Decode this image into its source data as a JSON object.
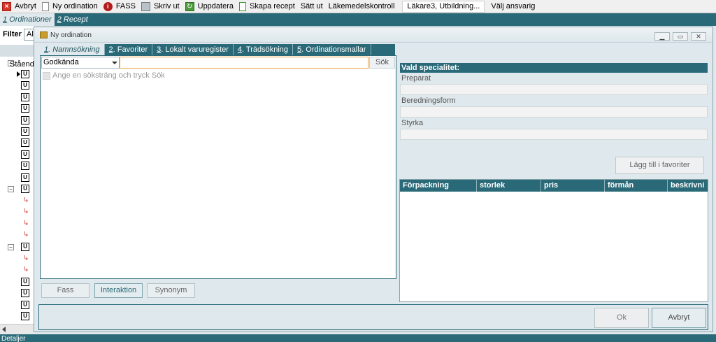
{
  "toolbar": {
    "items": [
      {
        "label": "Avbryt",
        "icon": "close-icon"
      },
      {
        "label": "Ny ordination",
        "icon": "document-icon"
      },
      {
        "label": "FASS",
        "icon": "fass-icon"
      },
      {
        "label": "Skriv ut",
        "icon": "printer-icon"
      },
      {
        "label": "Uppdatera",
        "icon": "refresh-icon"
      },
      {
        "label": "Skapa recept",
        "icon": "new-prescription-icon"
      },
      {
        "label": "Sätt ut"
      },
      {
        "label": "Läkemedelskontroll"
      },
      {
        "label": "Läkare3,  Utbildning..."
      },
      {
        "label": "Välj ansvarig"
      }
    ]
  },
  "main_tabs": [
    {
      "num": "1",
      "label": " Ordinationer"
    },
    {
      "num": "2",
      "label": " Recept"
    }
  ],
  "background": {
    "filter_label": "Filter",
    "filter_value": "Al",
    "tree_label": "Stående",
    "u_mark": "U",
    "status_text": "Detaljer"
  },
  "dialog": {
    "title": "Ny ordination",
    "window_buttons": {
      "minimize": "▁",
      "restore": "▭",
      "close": "✕"
    },
    "tabs": [
      {
        "num": "1",
        "label": ". Namnsökning"
      },
      {
        "num": "2",
        "label": ". Favoriter"
      },
      {
        "num": "3",
        "label": ". Lokalt varuregister"
      },
      {
        "num": "4",
        "label": ". Trädsökning"
      },
      {
        "num": "5",
        "label": ". Ordinationsmallar"
      }
    ],
    "search": {
      "filter_value": "Godkända",
      "input_value": "",
      "button_label": "Sök",
      "hint": "Ange en söksträng och tryck Sök"
    },
    "bottom_buttons": {
      "fass": "Fass",
      "interaction": "Interaktion",
      "synonym": "Synonym"
    },
    "right": {
      "header": "Vald specialitet:",
      "fields": [
        {
          "label": "Preparat",
          "value": ""
        },
        {
          "label": "Beredningsform",
          "value": ""
        },
        {
          "label": "Styrka",
          "value": ""
        }
      ],
      "add_favorite_label": "Lägg till i favoriter",
      "package_columns": [
        "Förpackning",
        "storlek",
        "pris",
        "förmån",
        "beskrivni"
      ]
    },
    "footer": {
      "ok_label": "Ok",
      "cancel_label": "Avbryt"
    }
  },
  "colors": {
    "accent": "#2a6a78",
    "background": "#dfe8ec",
    "search_focus": "#e8a040"
  }
}
